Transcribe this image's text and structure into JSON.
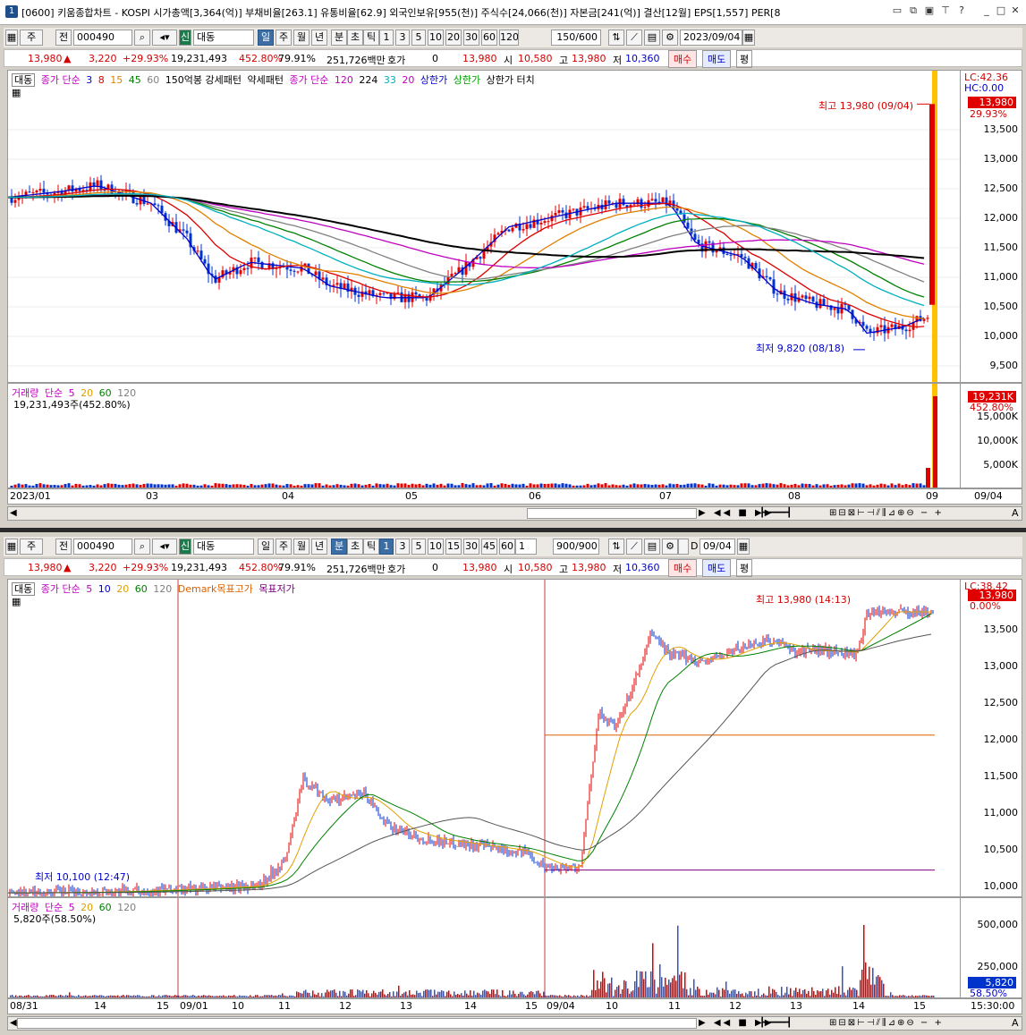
{
  "window": {
    "number": "1",
    "title": "[0600] 키움종합차트 - KOSPI 시가총액[3,364(억)] 부채비율[263.1] 유통비율[62.9] 외국인보유[955(천)] 주식수[24,066(천)] 자본금[241(억)] 결산[12월] EPS[1,557] PER[8"
  },
  "top": {
    "toolbar": {
      "type": "주",
      "mode": "전",
      "code": "000490",
      "market": "신",
      "name": "대동",
      "periods": [
        "일",
        "주",
        "월",
        "년",
        "분",
        "초",
        "틱"
      ],
      "intervals": [
        "1",
        "3",
        "5",
        "10",
        "20",
        "30",
        "60",
        "120"
      ],
      "count": "150/600",
      "date": "2023/09/04"
    },
    "info": {
      "price": "13,980",
      "change": "3,220",
      "rate": "+29.93%",
      "volume": "19,231,493",
      "volrate": "452.80%",
      "ratio": "79.91%",
      "amount": "251,726백만",
      "hoga_label": "호가",
      "hoga": "0",
      "cur": "13,980",
      "open_label": "시",
      "open": "10,580",
      "high_label": "고",
      "high": "13,980",
      "low_label": "저",
      "low": "10,360",
      "buy": "매수",
      "sell": "매도",
      "avg": "평"
    },
    "legend": {
      "name": "대동",
      "ma_label": "종가 단순",
      "ma": [
        "3",
        "8",
        "15",
        "45",
        "60"
      ],
      "ma_extra": "150억봉 강세패턴",
      "weak": "약세패턴",
      "ma2_label": "종가 단순",
      "ma2": [
        "120",
        "224",
        "33",
        "20"
      ],
      "upper": "상한가",
      "upper2": "상한가",
      "touch": "상한가 터치"
    },
    "lc": "LC:42.36",
    "hc": "HC:0.00",
    "high_note": "최고 13,980 (09/04)",
    "low_note": "최저 9,820 (08/18)",
    "price_tag": "13,980",
    "price_pct": "29.93%",
    "yticks": [
      "13,500",
      "13,000",
      "12,500",
      "12,000",
      "11,500",
      "11,000",
      "10,500",
      "10,000",
      "9,500"
    ],
    "vol_legend": {
      "label": "거래량",
      "ma_label": "단순",
      "ma": [
        "5",
        "20",
        "60",
        "120"
      ],
      "value": "19,231,493주(452.80%)"
    },
    "vol_tag": "19,231K",
    "vol_pct": "452.80%",
    "vol_yticks": [
      "15,000K",
      "10,000K",
      "5,000K"
    ],
    "xticks": [
      "2023/01",
      "03",
      "04",
      "05",
      "06",
      "07",
      "08",
      "09",
      "09/04"
    ]
  },
  "bottom": {
    "toolbar": {
      "type": "주",
      "mode": "전",
      "code": "000490",
      "market": "신",
      "name": "대동",
      "periods": [
        "일",
        "주",
        "월",
        "년",
        "분",
        "초",
        "틱"
      ],
      "intervals": [
        "1",
        "3",
        "5",
        "10",
        "15",
        "30",
        "45",
        "60"
      ],
      "unit": "1",
      "count": "900/900",
      "d_label": "D",
      "date": "09/04"
    },
    "info": {
      "price": "13,980",
      "change": "3,220",
      "rate": "+29.93%",
      "volume": "19,231,493",
      "volrate": "452.80%",
      "ratio": "79.91%",
      "amount": "251,726백만",
      "hoga_label": "호가",
      "hoga": "0",
      "cur": "13,980",
      "open_label": "시",
      "open": "10,580",
      "high_label": "고",
      "high": "13,980",
      "low_label": "저",
      "low": "10,360",
      "buy": "매수",
      "sell": "매도",
      "avg": "평"
    },
    "legend": {
      "name": "대동",
      "ma_label": "종가 단순",
      "ma": [
        "5",
        "10",
        "20",
        "60",
        "120"
      ],
      "demark": "Demark목표고가",
      "demark_low": "목표저가"
    },
    "lc": "LC:38.42",
    "high_note": "최고 13,980 (14:13)",
    "low_note": "최저 10,100 (12:47)",
    "price_tag": "13,980",
    "price_pct": "0.00%",
    "yticks": [
      "13,500",
      "13,000",
      "12,500",
      "12,000",
      "11,500",
      "11,000",
      "10,500",
      "10,000"
    ],
    "vol_legend": {
      "label": "거래량",
      "ma_label": "단순",
      "ma": [
        "5",
        "20",
        "60",
        "120"
      ],
      "value": "5,820주(58.50%)"
    },
    "vol_tag": "5,820",
    "vol_pct": "58.50%",
    "vol_yticks": [
      "500,000",
      "250,000"
    ],
    "xticks": [
      "08/31",
      "14",
      "15",
      "09/01",
      "10",
      "11",
      "12",
      "13",
      "14",
      "15",
      "09/04",
      "10",
      "11",
      "12",
      "13",
      "14",
      "15",
      "15:30:00"
    ]
  },
  "colors": {
    "up": "#e00000",
    "down": "#0033cc",
    "accent": "#1f4f8b"
  }
}
